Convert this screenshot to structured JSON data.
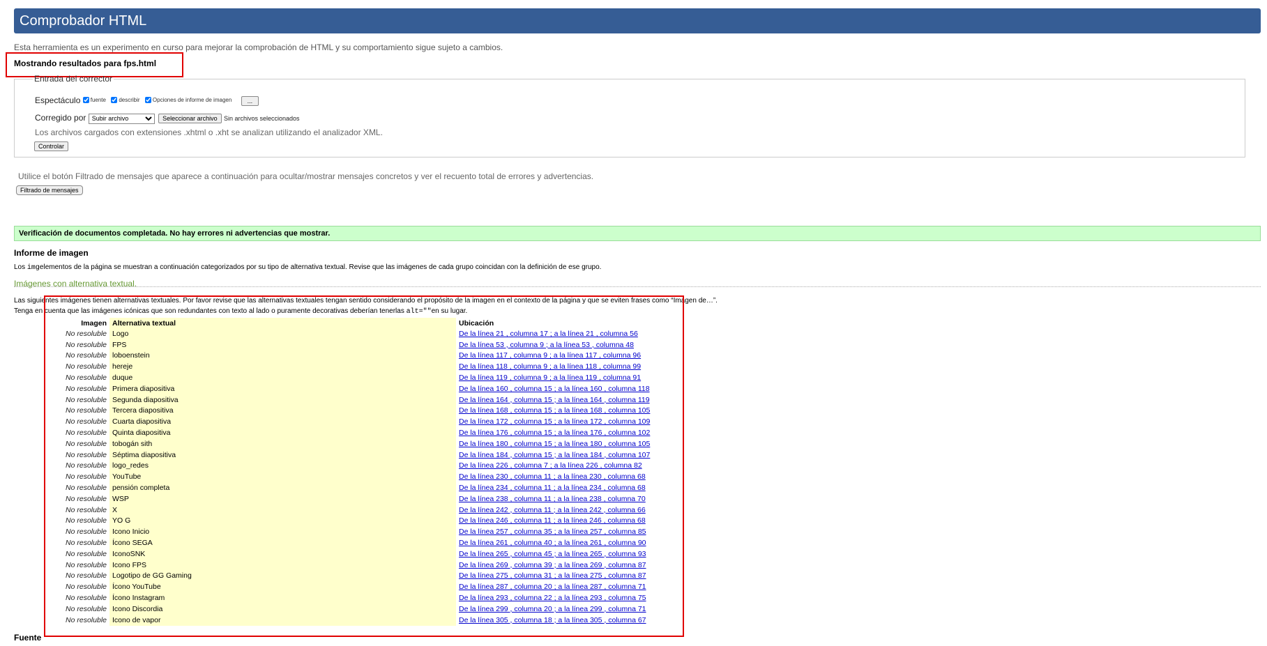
{
  "app": {
    "title": "Comprobador HTML"
  },
  "intro": "Esta herramienta es un experimento en curso para mejorar la comprobación de HTML y su comportamiento sigue sujeto a cambios.",
  "showing": "Mostrando resultados para fps.html",
  "checker": {
    "legend": "Entrada del corrector",
    "show_label": "Espectáculo",
    "options": [
      "fuente",
      "describir",
      "Opciones de informe de imagen"
    ],
    "more_button": "...",
    "checked_by_label": "Corregido por",
    "checked_by_value": "Subir archivo",
    "file_button": "Seleccionar archivo",
    "file_status": "Sin archivos seleccionados",
    "xml_note": "Los archivos cargados con extensiones .xhtml o .xht se analizan utilizando el analizador XML.",
    "check_button": "Controlar"
  },
  "filter_note": "Utilice el botón Filtrado de mensajes que aparece a continuación para ocultar/mostrar mensajes concretos y ver el recuento total de errores y advertencias.",
  "filter_button": "Filtrado de mensajes",
  "success": "Verificación de documentos completada. No hay errores ni advertencias que mostrar.",
  "image_report": {
    "title": "Informe de imagen",
    "desc_a": "Los ",
    "desc_code": "img",
    "desc_b": "elementos de la página se muestran a continuación categorizados por su tipo de alternativa textual. Revise que las imágenes de cada grupo coincidan con la definición de ese grupo.",
    "group_title": "Imágenes con alternativa textual.",
    "group_desc1": "Las siguientes imágenes tienen alternativas textuales. Por favor revise que las alternativas textuales tengan sentido considerando el propósito de la imagen en el contexto de la página y que se eviten frases como “Imagen de…”.",
    "group_desc2_a": "Tenga en cuenta que las imágenes icónicas que son redundantes con texto al lado o puramente decorativas deberían tenerlas ",
    "group_desc2_code": "alt=\"\"",
    "group_desc2_b": "en su lugar.",
    "headers": [
      "Imagen",
      "Alternativa textual",
      "Ubicación"
    ],
    "rows": [
      {
        "img": "No resoluble",
        "alt": "Logo",
        "loc": "De la línea 21 , columna 17 ; a la línea 21 , columna 56"
      },
      {
        "img": "No resoluble",
        "alt": "FPS",
        "loc": "De la línea 53 , columna 9 ; a la línea 53 , columna 48"
      },
      {
        "img": "No resoluble",
        "alt": "loboenstein",
        "loc": "De la línea 117 , columna 9 ; a la línea 117 , columna 96"
      },
      {
        "img": "No resoluble",
        "alt": "hereje",
        "loc": "De la línea 118 , columna 9 ; a la línea 118 , columna 99"
      },
      {
        "img": "No resoluble",
        "alt": "duque",
        "loc": "De la línea 119 , columna 9 ; a la línea 119 , columna 91"
      },
      {
        "img": "No resoluble",
        "alt": "Primera diapositiva",
        "loc": "De la línea 160 , columna 15 ; a la línea 160 , columna 118"
      },
      {
        "img": "No resoluble",
        "alt": "Segunda diapositiva",
        "loc": "De la línea 164 , columna 15 ; a la línea 164 , columna 119"
      },
      {
        "img": "No resoluble",
        "alt": "Tercera diapositiva",
        "loc": "De la línea 168 , columna 15 ; a la línea 168 , columna 105"
      },
      {
        "img": "No resoluble",
        "alt": "Cuarta diapositiva",
        "loc": "De la línea 172 , columna 15 ; a la línea 172 , columna 109"
      },
      {
        "img": "No resoluble",
        "alt": "Quinta diapositiva",
        "loc": "De la línea 176 , columna 15 ; a la línea 176 , columna 102"
      },
      {
        "img": "No resoluble",
        "alt": "tobogán sith",
        "loc": "De la línea 180 , columna 15 ; a la línea 180 , columna 105"
      },
      {
        "img": "No resoluble",
        "alt": "Séptima diapositiva",
        "loc": "De la línea 184 , columna 15 ; a la línea 184 , columna 107"
      },
      {
        "img": "No resoluble",
        "alt": "logo_redes",
        "loc": "De la línea 226 , columna 7 ; a la línea 226 , columna 82"
      },
      {
        "img": "No resoluble",
        "alt": "YouTube",
        "loc": "De la línea 230 , columna 11 ; a la línea 230 , columna 68"
      },
      {
        "img": "No resoluble",
        "alt": "pensión completa",
        "loc": "De la línea 234 , columna 11 ; a la línea 234 , columna 68"
      },
      {
        "img": "No resoluble",
        "alt": "WSP",
        "loc": "De la línea 238 , columna 11 ; a la línea 238 , columna 70"
      },
      {
        "img": "No resoluble",
        "alt": "X",
        "loc": "De la línea 242 , columna 11 ; a la línea 242 , columna 66"
      },
      {
        "img": "No resoluble",
        "alt": "YO G",
        "loc": "De la línea 246 , columna 11 ; a la línea 246 , columna 68"
      },
      {
        "img": "No resoluble",
        "alt": "Icono Inicio",
        "loc": "De la línea 257 , columna 35 ; a la línea 257 , columna 85"
      },
      {
        "img": "No resoluble",
        "alt": "Ícono SEGA",
        "loc": "De la línea 261 , columna 40 ; a la línea 261 , columna 90"
      },
      {
        "img": "No resoluble",
        "alt": "IconoSNK",
        "loc": "De la línea 265 , columna 45 ; a la línea 265 , columna 93"
      },
      {
        "img": "No resoluble",
        "alt": "Icono FPS",
        "loc": "De la línea 269 , columna 39 ; a la línea 269 , columna 87"
      },
      {
        "img": "No resoluble",
        "alt": "Logotipo de GG Gaming",
        "loc": "De la línea 275 , columna 31 ; a la línea 275 , columna 87"
      },
      {
        "img": "No resoluble",
        "alt": "Ícono YouTube",
        "loc": "De la línea 287 , columna 20 ; a la línea 287 , columna 71"
      },
      {
        "img": "No resoluble",
        "alt": "Ícono Instagram",
        "loc": "De la línea 293 , columna 22 ; a la línea 293 , columna 75"
      },
      {
        "img": "No resoluble",
        "alt": "Icono Discordia",
        "loc": "De la línea 299 , columna 20 ; a la línea 299 , columna 71"
      },
      {
        "img": "No resoluble",
        "alt": "Icono de vapor",
        "loc": "De la línea 305 , columna 18 ; a la línea 305 , columna 67"
      }
    ]
  },
  "source_title": "Fuente",
  "colors": {
    "banner": "#365d95",
    "success_bg": "#ccffcc",
    "alt_bg": "#ffffcc",
    "link": "#0000cc",
    "highlight": "#e00000"
  }
}
